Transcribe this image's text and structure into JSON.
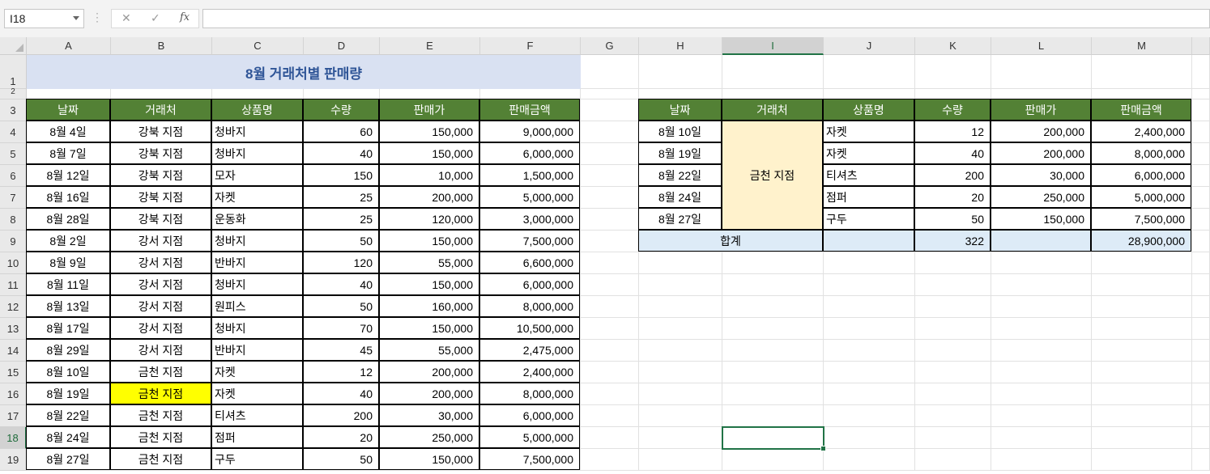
{
  "formula_bar": {
    "name_box": "I18",
    "cancel_icon": "✕",
    "enter_icon": "✓",
    "fx_label": "fx",
    "formula": ""
  },
  "columns": [
    "A",
    "B",
    "C",
    "D",
    "E",
    "F",
    "G",
    "H",
    "I",
    "J",
    "K",
    "L",
    "M"
  ],
  "selected_column": "I",
  "rows": [
    "1",
    "2",
    "3",
    "4",
    "5",
    "6",
    "7",
    "8",
    "9",
    "10",
    "11",
    "12",
    "13",
    "14",
    "15",
    "16",
    "17",
    "18",
    "19"
  ],
  "selected_row": "18",
  "title": "8월 거래처별 판매량",
  "headers": [
    "날짜",
    "거래처",
    "상품명",
    "수량",
    "판매가",
    "판매금액"
  ],
  "main_table": [
    [
      "8월 4일",
      "강북 지점",
      "청바지",
      "60",
      "150,000",
      "9,000,000"
    ],
    [
      "8월 7일",
      "강북 지점",
      "청바지",
      "40",
      "150,000",
      "6,000,000"
    ],
    [
      "8월 12일",
      "강북 지점",
      "모자",
      "150",
      "10,000",
      "1,500,000"
    ],
    [
      "8월 16일",
      "강북 지점",
      "자켓",
      "25",
      "200,000",
      "5,000,000"
    ],
    [
      "8월 28일",
      "강북 지점",
      "운동화",
      "25",
      "120,000",
      "3,000,000"
    ],
    [
      "8월 2일",
      "강서 지점",
      "청바지",
      "50",
      "150,000",
      "7,500,000"
    ],
    [
      "8월 9일",
      "강서 지점",
      "반바지",
      "120",
      "55,000",
      "6,600,000"
    ],
    [
      "8월 11일",
      "강서 지점",
      "청바지",
      "40",
      "150,000",
      "6,000,000"
    ],
    [
      "8월 13일",
      "강서 지점",
      "원피스",
      "50",
      "160,000",
      "8,000,000"
    ],
    [
      "8월 17일",
      "강서 지점",
      "청바지",
      "70",
      "150,000",
      "10,500,000"
    ],
    [
      "8월 29일",
      "강서 지점",
      "반바지",
      "45",
      "55,000",
      "2,475,000"
    ],
    [
      "8월 10일",
      "금천 지점",
      "자켓",
      "12",
      "200,000",
      "2,400,000"
    ],
    [
      "8월 19일",
      "금천 지점",
      "자켓",
      "40",
      "200,000",
      "8,000,000"
    ],
    [
      "8월 22일",
      "금천 지점",
      "티셔츠",
      "200",
      "30,000",
      "6,000,000"
    ],
    [
      "8월 24일",
      "금천 지점",
      "점퍼",
      "20",
      "250,000",
      "5,000,000"
    ],
    [
      "8월 27일",
      "금천 지점",
      "구두",
      "50",
      "150,000",
      "7,500,000"
    ]
  ],
  "highlight_cell": "B16",
  "right_table": {
    "branch": "금천 지점",
    "rows": [
      [
        "8월 10일",
        "자켓",
        "12",
        "200,000",
        "2,400,000"
      ],
      [
        "8월 19일",
        "자켓",
        "40",
        "200,000",
        "8,000,000"
      ],
      [
        "8월 22일",
        "티셔츠",
        "200",
        "30,000",
        "6,000,000"
      ],
      [
        "8월 24일",
        "점퍼",
        "20",
        "250,000",
        "5,000,000"
      ],
      [
        "8월 27일",
        "구두",
        "50",
        "150,000",
        "7,500,000"
      ]
    ],
    "total_label": "합계",
    "total_qty": "322",
    "total_amount": "28,900,000"
  },
  "colors": {
    "header_green": "#538135",
    "title_fill": "#d9e1f2",
    "title_text": "#2f5597",
    "highlight_yellow": "#ffff00",
    "merged_fill": "#fff2cc",
    "total_fill": "#ddebf7",
    "selection": "#217346"
  }
}
